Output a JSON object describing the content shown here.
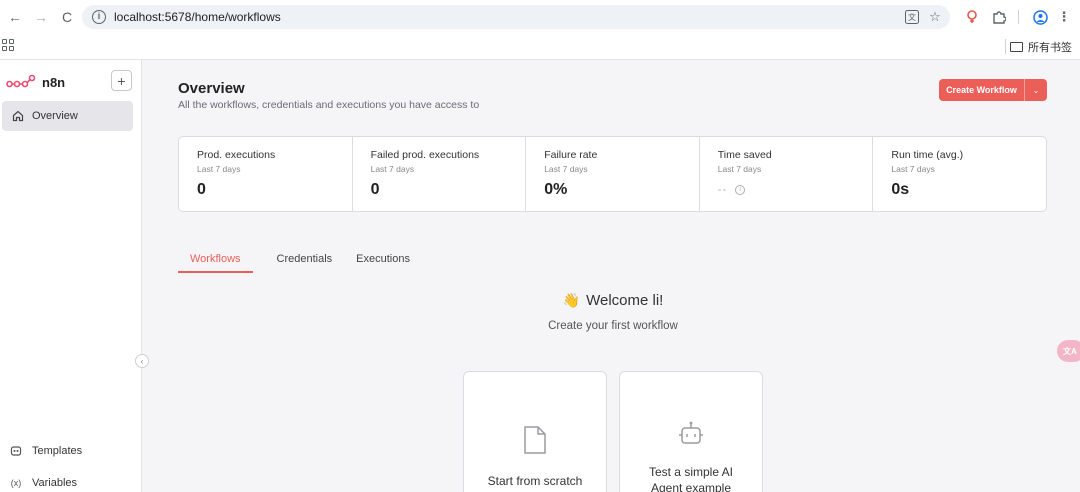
{
  "browser": {
    "url": "localhost:5678/home/workflows",
    "bookmarks_folder": "所有书签",
    "translate_badge": "文A"
  },
  "sidebar": {
    "brand": "n8n",
    "add_label": "+",
    "overview_label": "Overview",
    "bottom_items": [
      {
        "label": "Templates",
        "icon": "templates-icon"
      },
      {
        "label": "Variables",
        "icon": "variables-icon"
      }
    ]
  },
  "header": {
    "title": "Overview",
    "subtitle": "All the workflows, credentials and executions you have access to",
    "create_button": "Create Workflow"
  },
  "stats": [
    {
      "label": "Prod. executions",
      "sub": "Last 7 days",
      "value": "0"
    },
    {
      "label": "Failed prod. executions",
      "sub": "Last 7 days",
      "value": "0"
    },
    {
      "label": "Failure rate",
      "sub": "Last 7 days",
      "value": "0%"
    },
    {
      "label": "Time saved",
      "sub": "Last 7 days",
      "value": "--"
    },
    {
      "label": "Run time (avg.)",
      "sub": "Last 7 days",
      "value": "0s"
    }
  ],
  "tabs": [
    {
      "label": "Workflows",
      "active": true
    },
    {
      "label": "Credentials",
      "active": false
    },
    {
      "label": "Executions",
      "active": false
    }
  ],
  "welcome": {
    "emoji": "👋",
    "title": "Welcome li!",
    "subtitle": "Create your first workflow"
  },
  "cards": [
    {
      "label": "Start from scratch",
      "icon": "file-icon"
    },
    {
      "label": "Test a simple AI Agent example",
      "icon": "robot-icon"
    }
  ],
  "colors": {
    "accent": "#ec5f59",
    "sidebar_active": "#e6e6ea",
    "background": "#f5f5f7"
  }
}
